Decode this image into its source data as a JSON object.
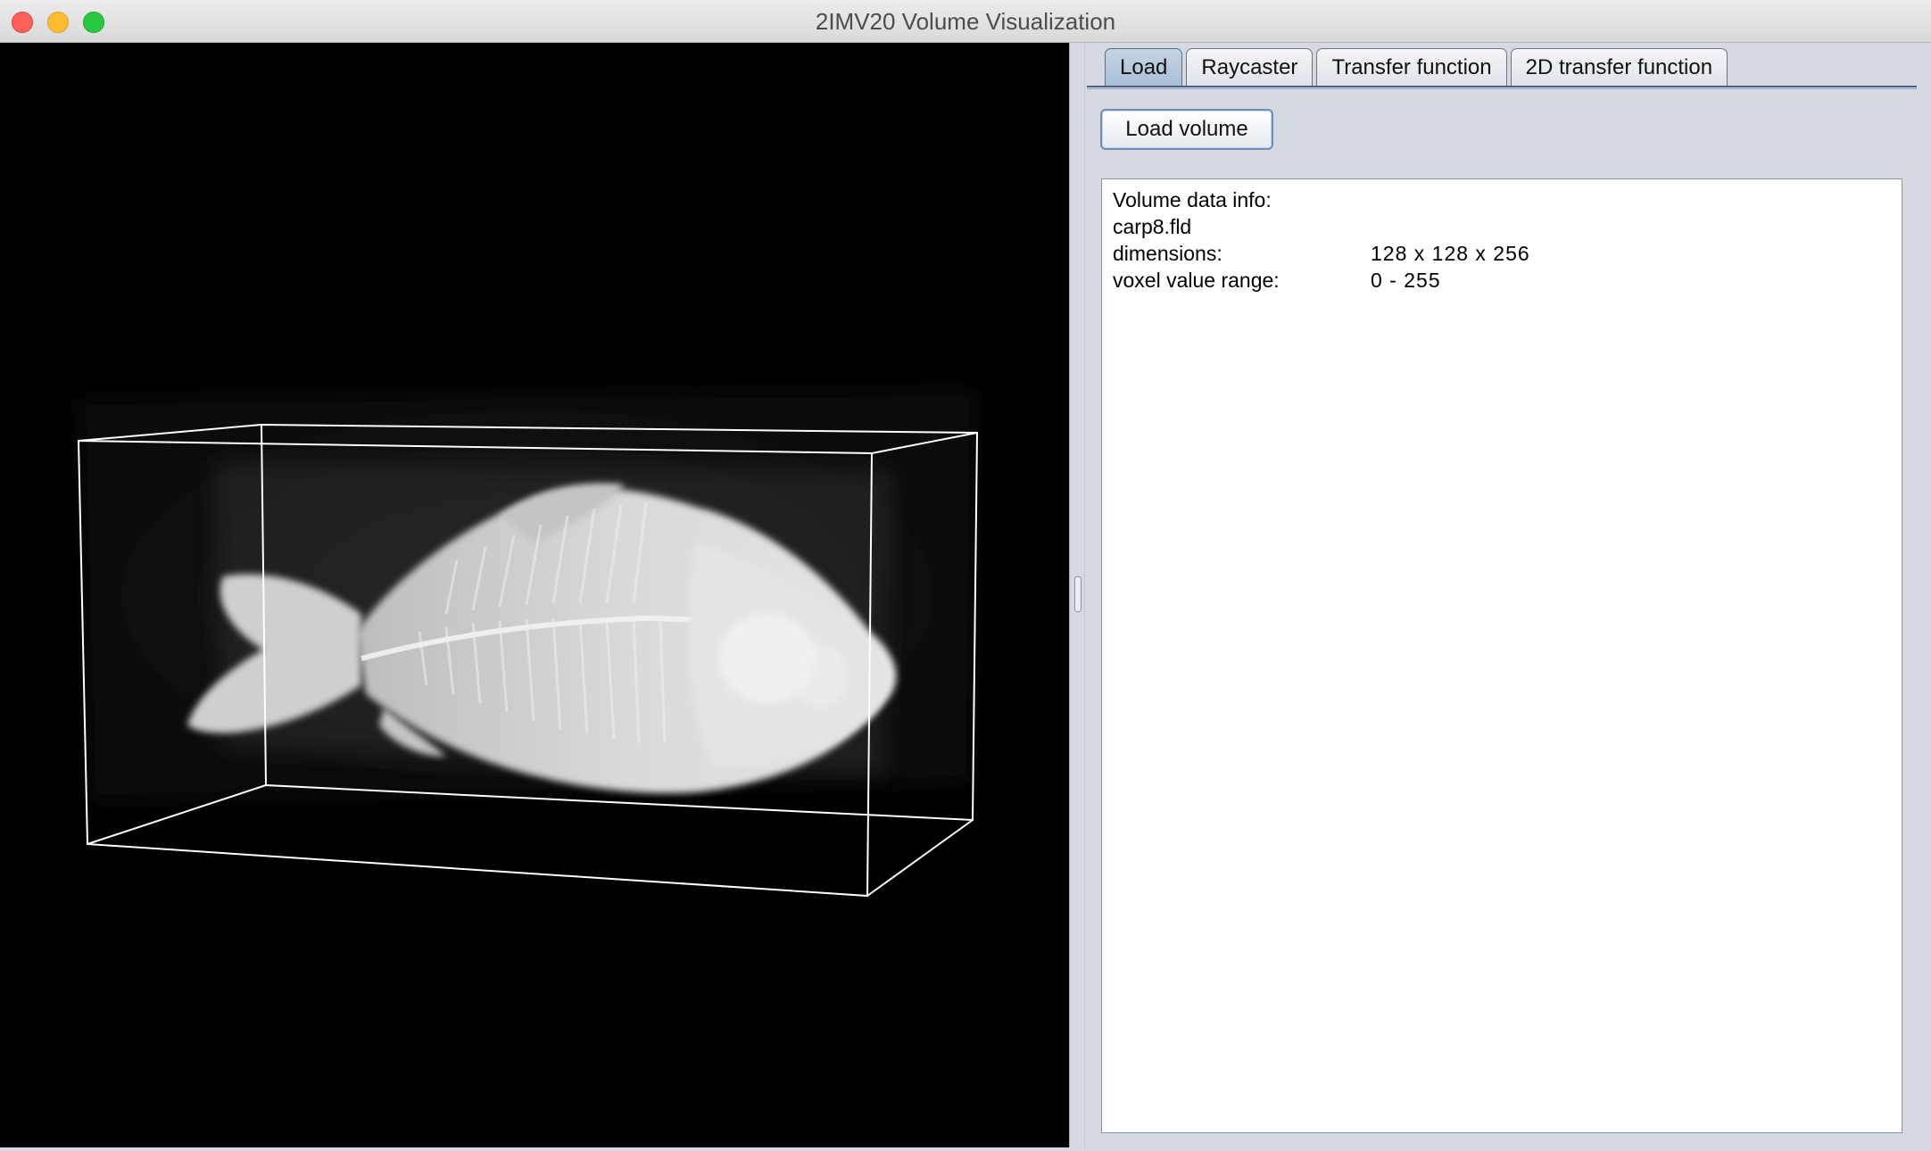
{
  "window": {
    "title": "2IMV20 Volume Visualization"
  },
  "viewport": {
    "content": "volume-render-carp",
    "background_color": "#000000",
    "bounding_box_color": "#ffffff"
  },
  "tabs": [
    {
      "label": "Load",
      "active": true
    },
    {
      "label": "Raycaster",
      "active": false
    },
    {
      "label": "Transfer function",
      "active": false
    },
    {
      "label": "2D transfer function",
      "active": false
    }
  ],
  "load_panel": {
    "load_button_label": "Load volume",
    "info": {
      "heading": "Volume data info:",
      "filename": "carp8.fld",
      "dimensions_label": "dimensions:",
      "dimensions_value": "128 x 128 x 256",
      "range_label": "voxel value range:",
      "range_value": "0 - 255"
    }
  },
  "colors": {
    "active_tab": "#b3c6dc",
    "panel_bg": "#d5d9e1",
    "accent_border": "#6f8db8"
  }
}
